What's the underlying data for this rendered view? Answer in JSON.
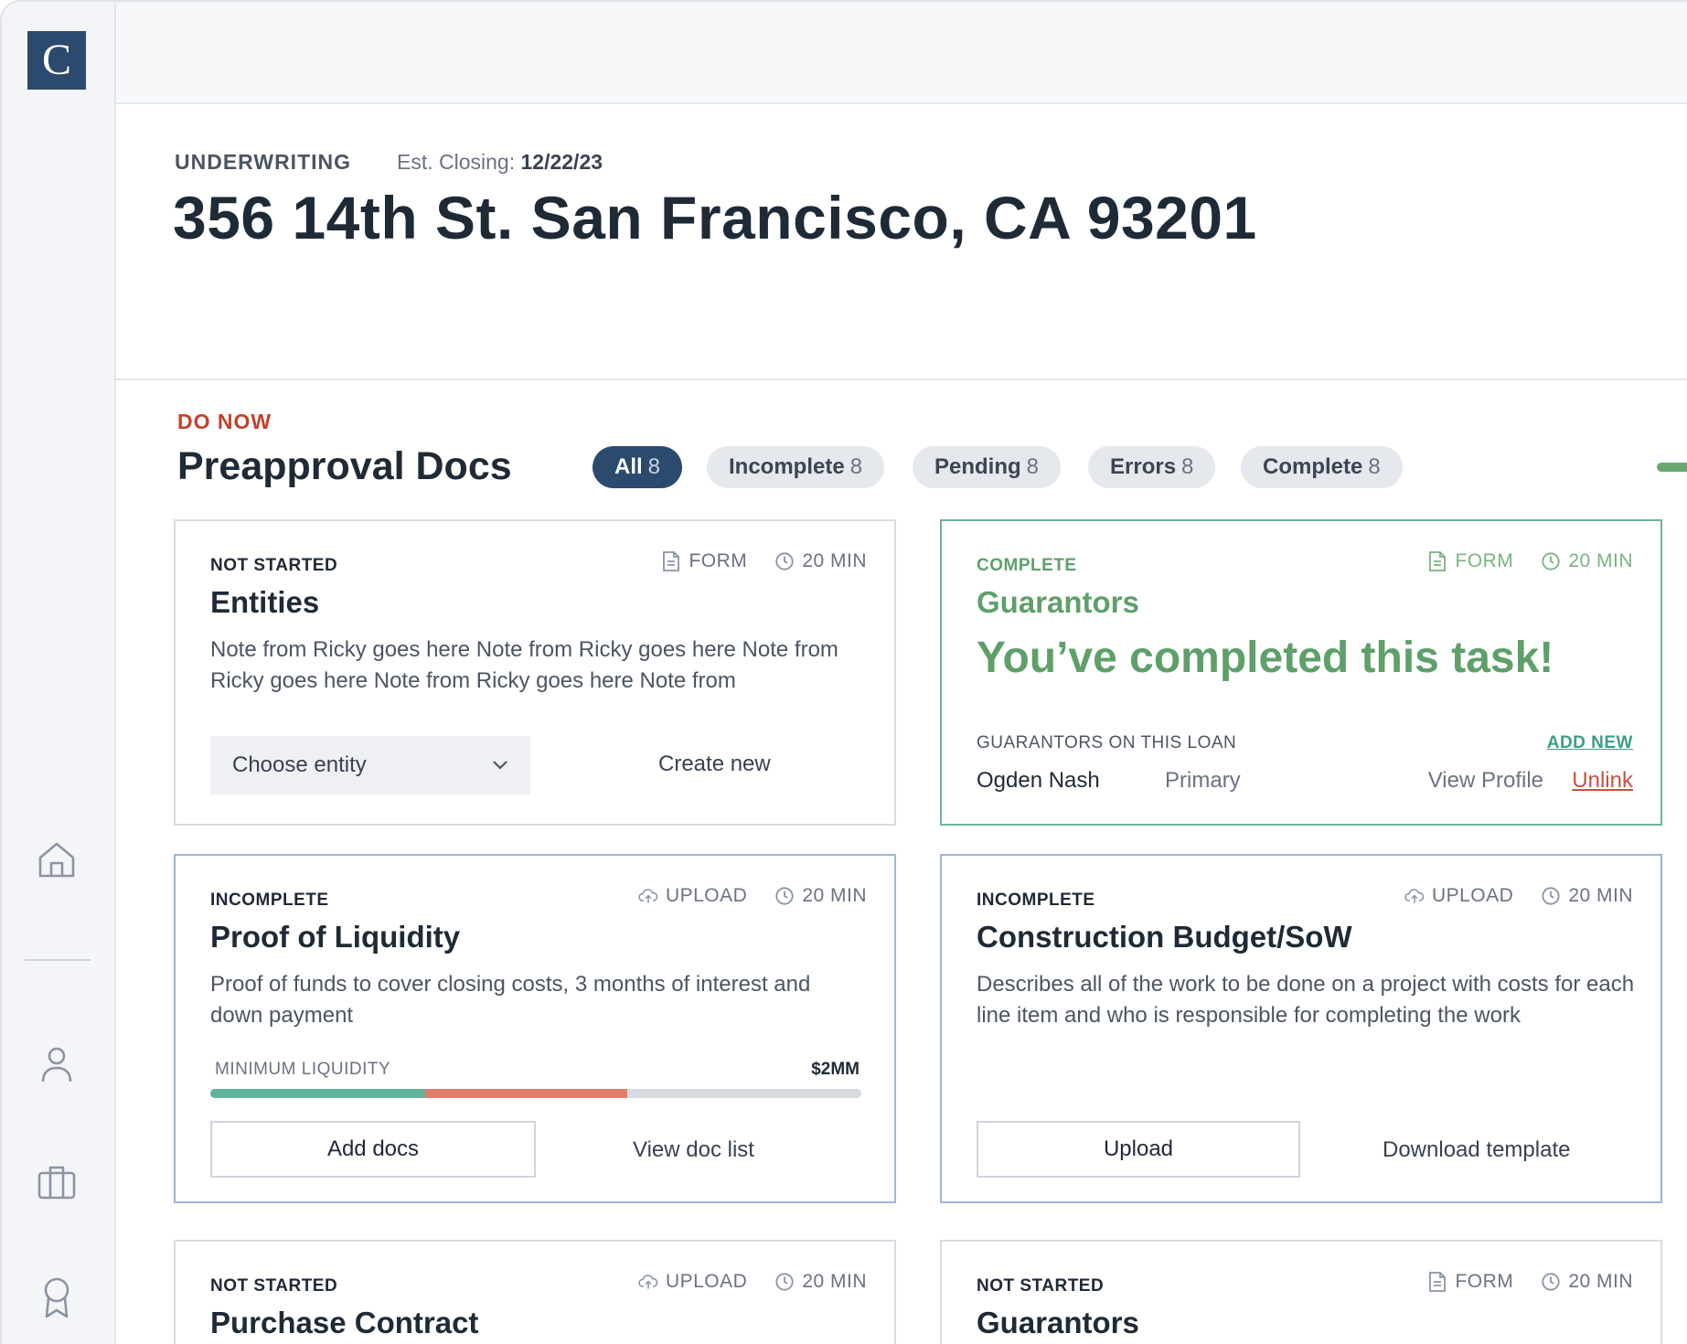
{
  "app": {
    "logo_letter": "C"
  },
  "sidebar": {
    "items": [
      {
        "name": "home-icon"
      },
      {
        "name": "user-icon"
      },
      {
        "name": "briefcase-icon"
      },
      {
        "name": "award-icon"
      }
    ]
  },
  "header": {
    "stage": "UNDERWRITING",
    "est_label": "Est. Closing:",
    "est_date": "12/22/23",
    "address": "356 14th St. San Francisco, CA 93201"
  },
  "section": {
    "eyebrow": "DO NOW",
    "title": "Preapproval Docs",
    "filters": [
      {
        "label": "All",
        "count": "8",
        "active": true
      },
      {
        "label": "Incomplete",
        "count": "8",
        "active": false
      },
      {
        "label": "Pending",
        "count": "8",
        "active": false
      },
      {
        "label": "Errors",
        "count": "8",
        "active": false
      },
      {
        "label": "Complete",
        "count": "8",
        "active": false
      }
    ]
  },
  "cards": {
    "entities": {
      "status": "NOT STARTED",
      "type": "FORM",
      "time": "20 MIN",
      "title": "Entities",
      "desc": "Note from Ricky goes here Note from Ricky goes here Note from Ricky goes here Note from Ricky goes here Note from",
      "select_value": "Choose entity",
      "secondary": "Create new"
    },
    "guarantors_complete": {
      "status": "COMPLETE",
      "type": "FORM",
      "time": "20 MIN",
      "title": "Guarantors",
      "message": "You’ve completed this task!",
      "list_label": "GUARANTORS ON THIS LOAN",
      "add_new": "ADD NEW",
      "guarantor_name": "Ogden Nash",
      "guarantor_role": "Primary",
      "view_profile": "View Profile",
      "unlink": "Unlink"
    },
    "liquidity": {
      "status": "INCOMPLETE",
      "type": "UPLOAD",
      "time": "20 MIN",
      "title": "Proof of Liquidity",
      "desc": "Proof of funds to cover closing costs, 3 months of interest and down payment",
      "min_label": "MINIMUM LIQUIDITY",
      "min_value": "$2MM",
      "progress": {
        "green_fraction": 0.33,
        "red_fraction": 0.31
      },
      "primary": "Add docs",
      "secondary": "View doc list"
    },
    "budget": {
      "status": "INCOMPLETE",
      "type": "UPLOAD",
      "time": "20 MIN",
      "title": "Construction Budget/SoW",
      "desc": "Describes all of the work to be done on a project with costs for each line item and who is responsible for completing the work",
      "primary": "Upload",
      "secondary": "Download template"
    },
    "purchase": {
      "status": "NOT STARTED",
      "type": "UPLOAD",
      "time": "20 MIN",
      "title": "Purchase Contract"
    },
    "guarantors": {
      "status": "NOT STARTED",
      "type": "FORM",
      "time": "20 MIN",
      "title": "Guarantors"
    }
  },
  "colors": {
    "brand": "#2c4a6e",
    "danger": "#c2412d",
    "success": "#5e9f6a",
    "progress_green": "#5fb39a",
    "progress_red": "#e27d6b"
  }
}
